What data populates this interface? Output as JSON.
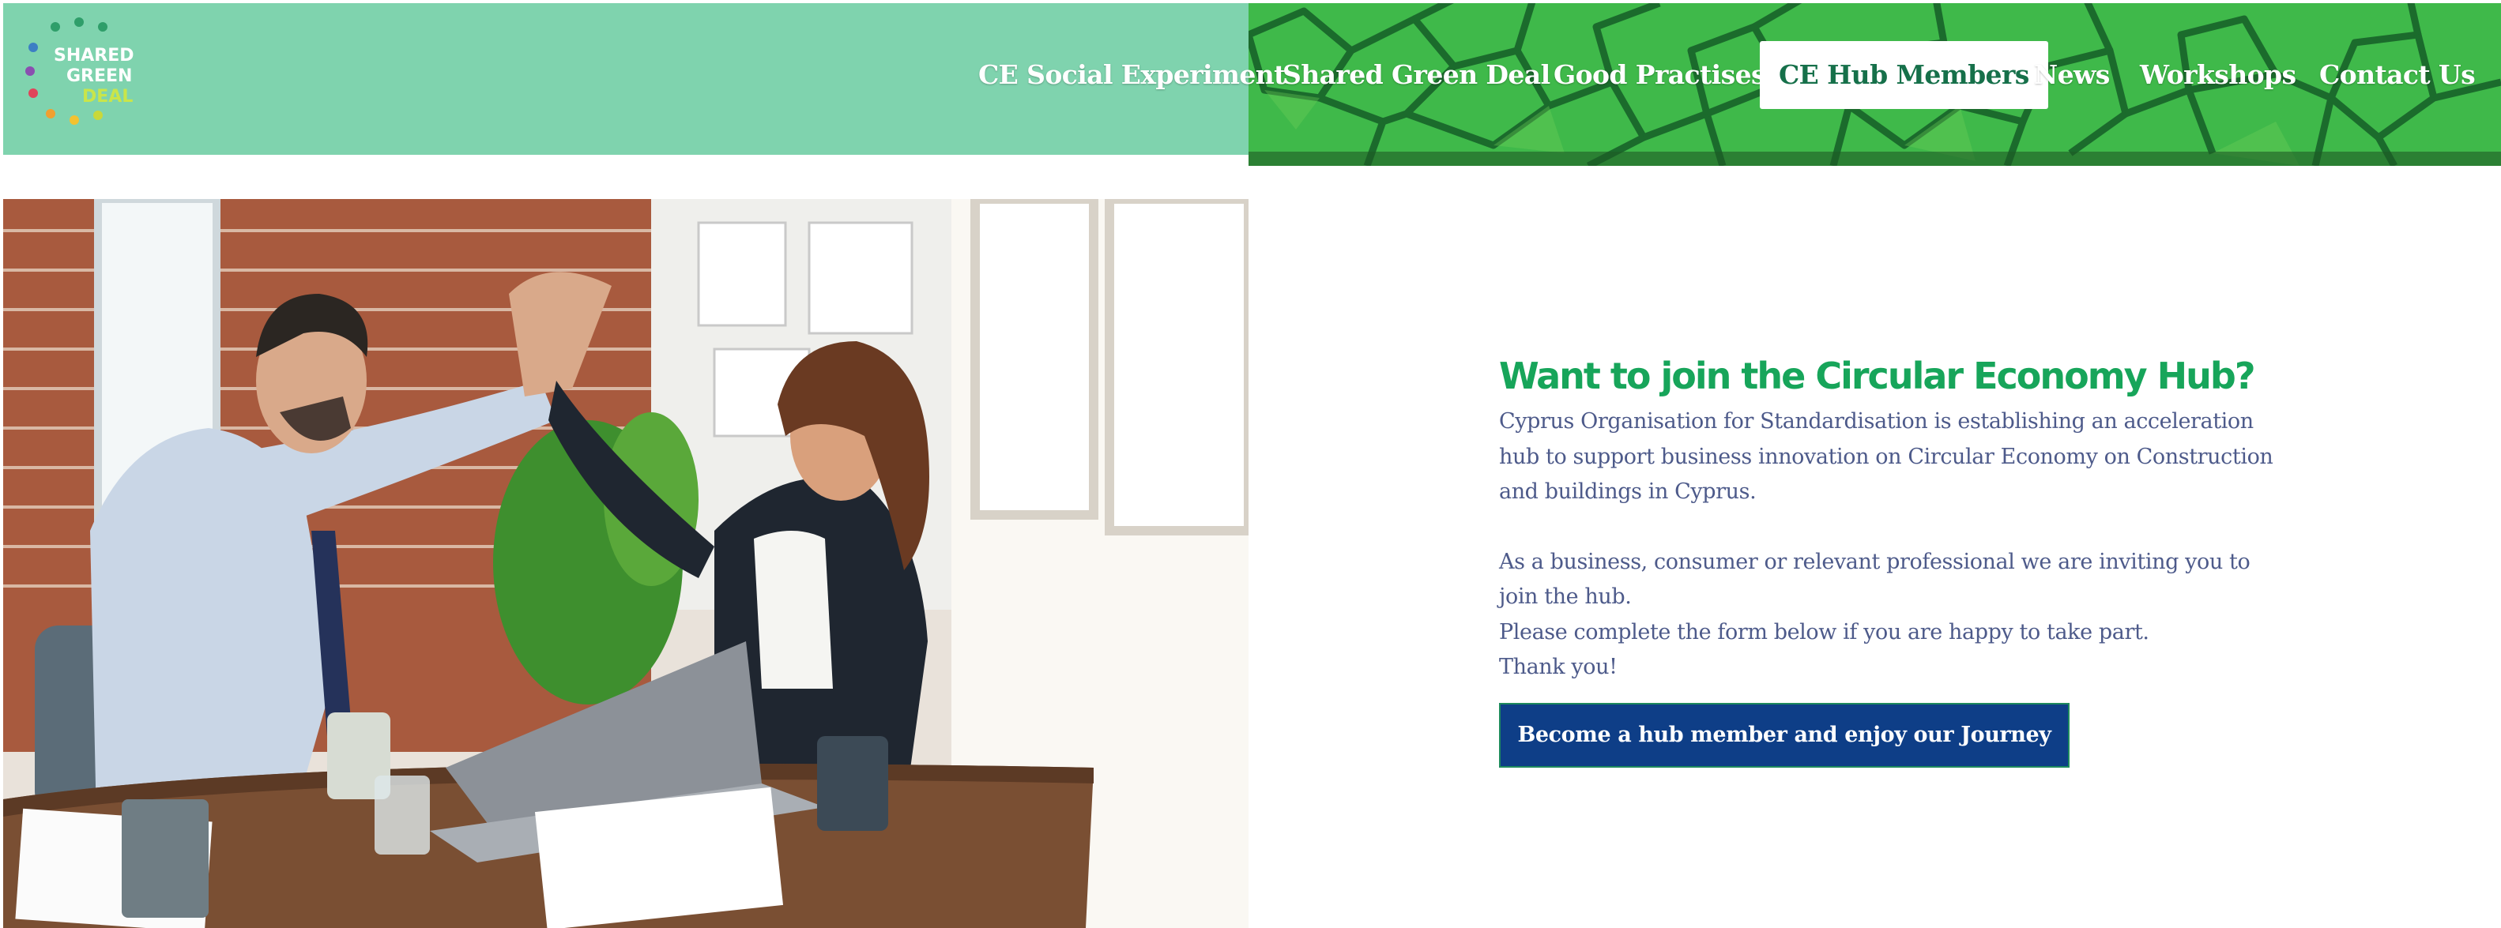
{
  "logo": {
    "line1": "SHARED",
    "line2": "GREEN",
    "line3": "DEAL",
    "icon": "people-circle-logo-icon"
  },
  "nav": {
    "items": [
      {
        "label": "CE Social Experiment",
        "active": false
      },
      {
        "label": "Shared Green Deal",
        "active": false
      },
      {
        "label": "Good Practises",
        "active": false
      },
      {
        "label": "CE Hub Members",
        "active": true
      },
      {
        "label": "News",
        "active": false
      },
      {
        "label": "Workshops",
        "active": false
      },
      {
        "label": "Contact Us",
        "active": false
      }
    ]
  },
  "hero": {
    "image": "business-people-high-five-photo"
  },
  "join": {
    "title": "Want to join the Circular Economy Hub?",
    "intro": "Cyprus Organisation for Standardisation is establishing an acceleration hub to support business innovation on Circular Economy on Construction and buildings in Cyprus.",
    "invite": "As a business, consumer or relevant professional we are inviting you to join the hub.",
    "form_note": "Please complete the form below if you are happy to take part.",
    "thanks": "Thank you!",
    "cta_label": "Become a hub member and enjoy our Journey"
  },
  "colors": {
    "header_mint": "#7fd3ae",
    "header_green": "#3cb648",
    "title_green": "#17a55a",
    "body_text": "#4d5a8a",
    "button_blue": "#0e3e87"
  }
}
